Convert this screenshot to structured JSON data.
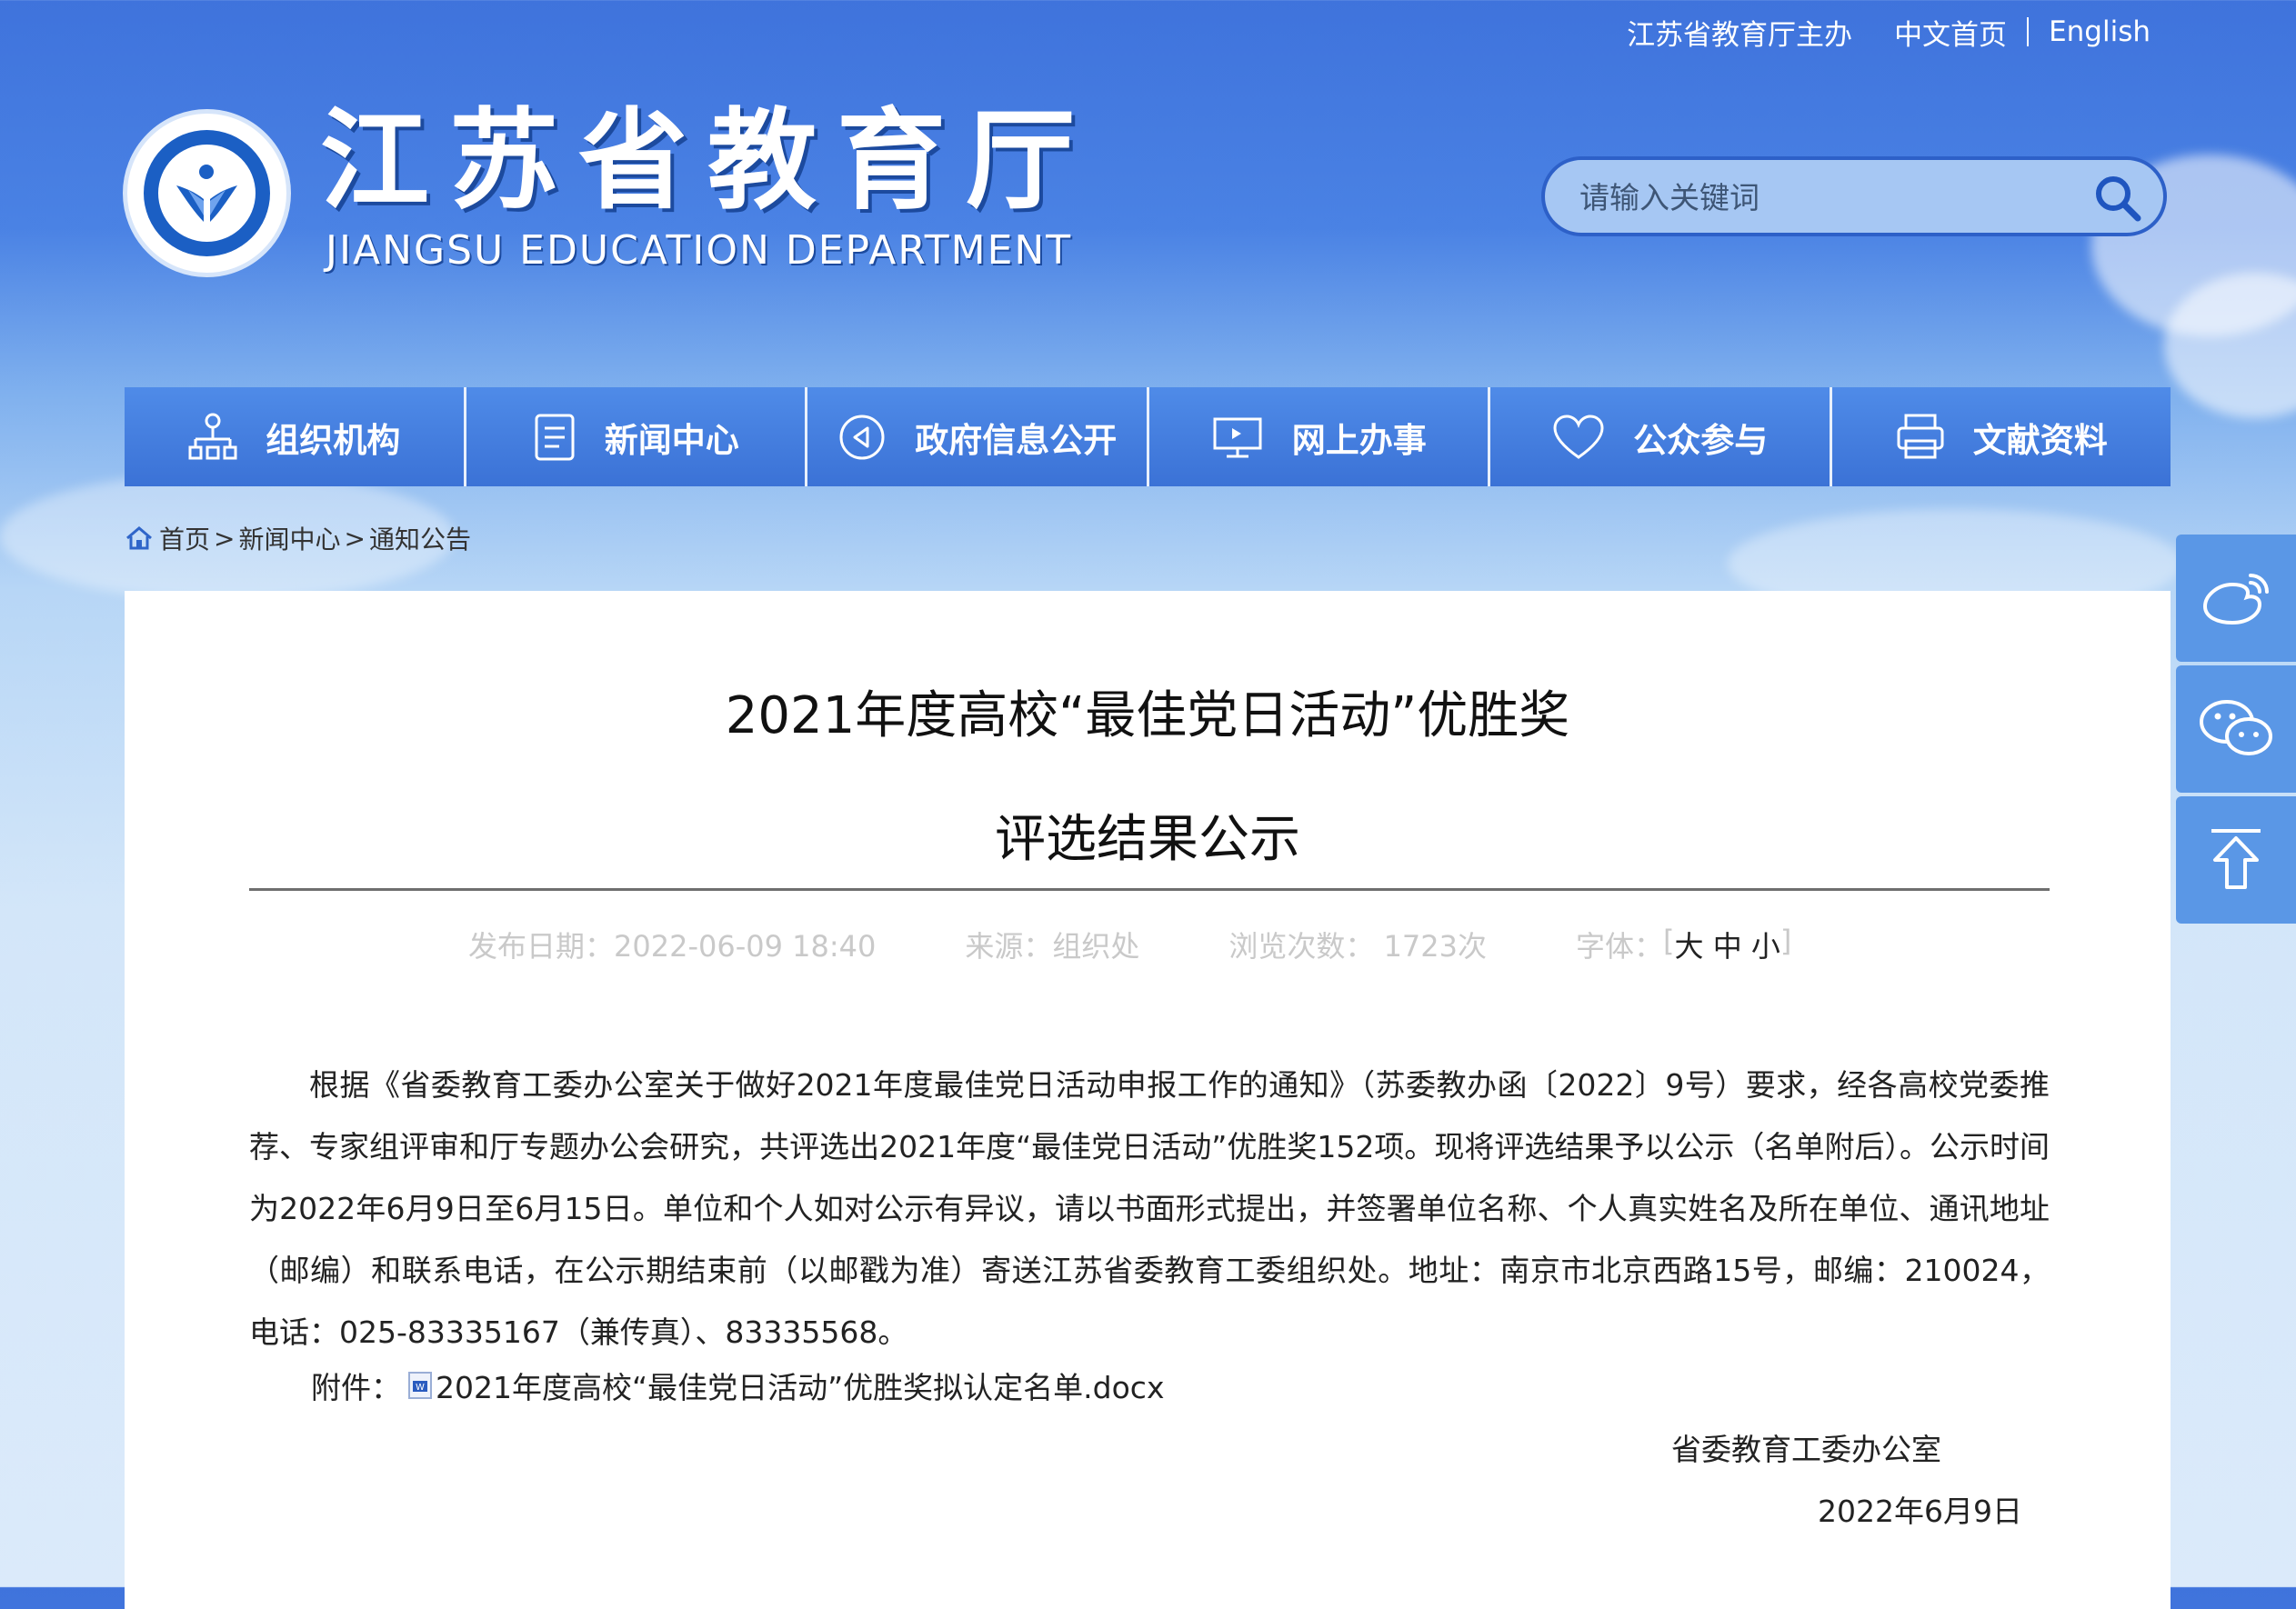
{
  "topbar": {
    "host": "江苏省教育厅主办",
    "home_cn": "中文首页",
    "english": "English"
  },
  "header": {
    "title": "江苏省教育厅",
    "subtitle": "JIANGSU EDUCATION DEPARTMENT",
    "logo_icon": "jiangsu-education-emblem"
  },
  "search": {
    "placeholder": "请输入关键词",
    "icon": "search-icon"
  },
  "nav": {
    "items": [
      {
        "label": "组织机构",
        "icon": "org-chart-icon"
      },
      {
        "label": "新闻中心",
        "icon": "document-icon"
      },
      {
        "label": "政府信息公开",
        "icon": "play-circle-icon"
      },
      {
        "label": "网上办事",
        "icon": "monitor-icon"
      },
      {
        "label": "公众参与",
        "icon": "heart-icon"
      },
      {
        "label": "文献资料",
        "icon": "printer-icon"
      }
    ]
  },
  "breadcrumb": {
    "home": "首页",
    "sep": ">",
    "news": "新闻中心",
    "notice": "通知公告",
    "icon": "home-icon"
  },
  "article": {
    "title_line1": "2021年度高校“最佳党日活动”优胜奖",
    "title_line2": "评选结果公示",
    "meta": {
      "date": "发布日期：2022-06-09 18:40",
      "source": "来源：组织处",
      "views": "浏览次数： 1723次",
      "font_label": "字体：",
      "bracket_open": "[",
      "size_large": "大",
      "size_medium": "中",
      "size_small": "小",
      "bracket_close": "]"
    },
    "body": "根据《省委教育工委办公室关于做好2021年度最佳党日活动申报工作的通知》（苏委教办函〔2022〕9号）要求，经各高校党委推荐、专家组评审和厅专题办公会研究，共评选出2021年度“最佳党日活动”优胜奖152项。现将评选结果予以公示（名单附后）。公示时间为2022年6月9日至6月15日。单位和个人如对公示有异议，请以书面形式提出，并签署单位名称、个人真实姓名及所在单位、通讯地址（邮编）和联系电话，在公示期结束前（以邮戳为准）寄送江苏省委教育工委组织处。地址：南京市北京西路15号，邮编：210024，电话：025-83335167（兼传真）、83335568。",
    "attachment_label": "附件：",
    "attachment_link": "2021年度高校“最佳党日活动”优胜奖拟认定名单.docx",
    "signature": "省委教育工委办公室",
    "sign_date": "2022年6月9日"
  },
  "side_buttons": [
    "weibo-icon",
    "wechat-icon",
    "back-to-top-icon"
  ],
  "colors": {
    "nav_bg": "#4a84e4",
    "header_bg": "#3f73dc",
    "side_bg": "#5a97e6"
  }
}
